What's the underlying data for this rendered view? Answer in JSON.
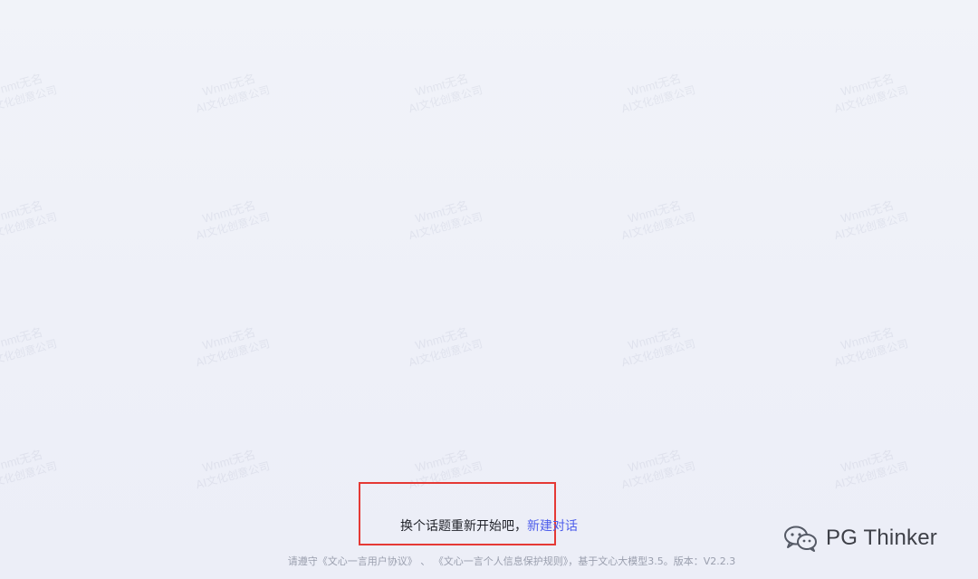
{
  "watermark": {
    "line1": "Wnmt无名",
    "line2": "AI文化创意公司"
  },
  "prompt": {
    "restart_text": "换个话题重新开始吧，",
    "new_chat_label": "新建对话"
  },
  "footer": {
    "prefix": "请遵守",
    "user_agreement": "《文心一言用户协议》",
    "separator": "、",
    "privacy_rules": "《文心一言个人信息保护规则》",
    "suffix": "，基于文心大模型3.5。版本：V2.2.3"
  },
  "brand": {
    "icon": "wechat-icon",
    "name": "PG Thinker"
  },
  "colors": {
    "link": "#4e5eeb",
    "highlight_border": "#e53935"
  }
}
